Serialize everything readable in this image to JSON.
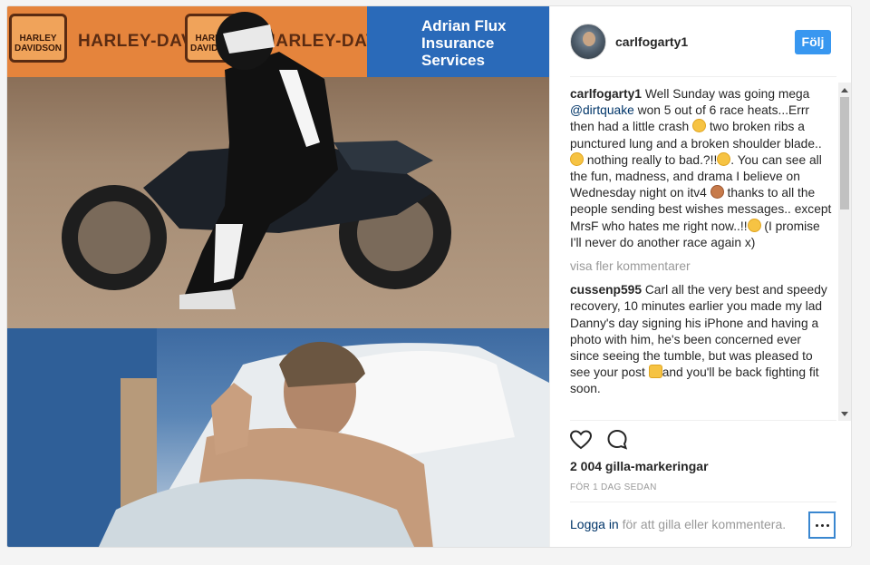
{
  "images": {
    "top_banner_texts": [
      "HARLEY-DAVIDSON",
      "HARLEY-DAVIDSON"
    ],
    "top_banner_logo": "HARLEY DAVIDSON",
    "sponsor_text": "Adrian Flux Insurance Services"
  },
  "header": {
    "username": "carlfogarty1",
    "follow_label": "Följ"
  },
  "caption": {
    "username": "carlfogarty1",
    "text_1": "Well Sunday was going mega",
    "mention": "@dirtquake",
    "text_2": "won 5 out of 6 race heats...Errr then had a little crash",
    "text_3": "two broken ribs a punctured lung and a broken shoulder blade..",
    "text_4": "nothing really to bad.?!!",
    "text_5": ". You can see all the fun, madness, and drama I believe on Wednesday night on itv4",
    "text_6": "thanks to all the people sending best wishes messages.. except MrsF who hates me right now..!!",
    "text_7": "(I promise I'll never do another race again x)"
  },
  "more_comments_label": "visa fler kommentarer",
  "comment": {
    "username": "cussenp595",
    "text_1": "Carl all the very best and speedy recovery, 10 minutes earlier you made my lad Danny's day signing his iPhone and having a photo with him, he's been concerned ever since seeing the tumble, but was pleased to see your post",
    "text_2": "and you'll be back fighting fit soon."
  },
  "actions": {
    "like_icon": "heart-icon",
    "comment_icon": "comment-icon"
  },
  "likes_label": "2 004 gilla-markeringar",
  "time_label": "FÖR 1 DAG SEDAN",
  "footer": {
    "login_link": "Logga in",
    "login_rest": "för att gilla eller kommentera.",
    "more_icon": "more-options-icon"
  },
  "colors": {
    "accent": "#3897f0",
    "link": "#003569",
    "muted": "#999999"
  }
}
